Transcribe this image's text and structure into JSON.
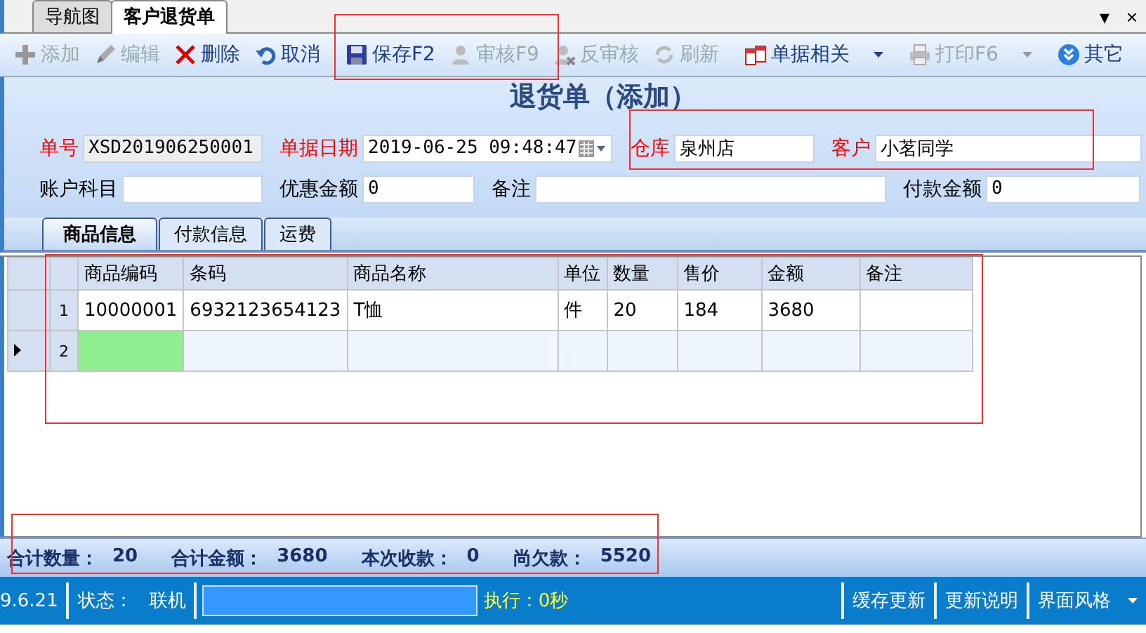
{
  "doc_tabs": [
    {
      "label": "导航图",
      "selected": false
    },
    {
      "label": "客户退货单",
      "selected": true
    }
  ],
  "window_controls": {
    "menu": "▾",
    "close": "×"
  },
  "toolbar": [
    {
      "label": "添加",
      "kind": "button",
      "disabled": true
    },
    {
      "label": "编辑",
      "kind": "button",
      "disabled": true
    },
    {
      "label": "删除",
      "kind": "button",
      "disabled": false
    },
    {
      "label": "取消",
      "kind": "button",
      "disabled": false
    },
    {
      "label": "保存F2",
      "kind": "button",
      "disabled": false
    },
    {
      "label": "审核F9",
      "kind": "button",
      "disabled": true
    },
    {
      "label": "反审核",
      "kind": "button",
      "disabled": true
    },
    {
      "label": "刷新",
      "kind": "button",
      "disabled": true
    },
    {
      "label": "单据相关",
      "kind": "dropdown",
      "disabled": false
    },
    {
      "label": "打印F6",
      "kind": "dropdown",
      "disabled": true
    },
    {
      "label": "其它",
      "kind": "dropdown",
      "disabled": false
    }
  ],
  "form": {
    "title": "退货单（添加）",
    "fields": [
      {
        "label": "单号",
        "required": true,
        "value": "XSD201906250001",
        "kind": "readonly"
      },
      {
        "label": "单据日期",
        "required": true,
        "value": "2019-06-25 09:48:47",
        "kind": "date"
      },
      {
        "label": "仓库",
        "required": true,
        "value": "泉州店",
        "kind": "text"
      },
      {
        "label": "客户",
        "required": true,
        "value": "小茗同学",
        "kind": "text"
      },
      {
        "label": "账户科目",
        "required": false,
        "kind": "text"
      },
      {
        "label": "优惠金额",
        "required": false,
        "value": "0",
        "kind": "text"
      },
      {
        "label": "备注",
        "required": false,
        "kind": "text"
      },
      {
        "label": "付款金额",
        "required": false,
        "value": "0",
        "kind": "text"
      }
    ]
  },
  "detail_tabs": [
    {
      "label": "商品信息",
      "selected": true
    },
    {
      "label": "付款信息",
      "selected": false
    },
    {
      "label": "运费",
      "selected": false
    }
  ],
  "table": {
    "columns": [
      "商品编码",
      "条码",
      "商品名称",
      "单位",
      "数量",
      "售价",
      "金额",
      "备注"
    ],
    "rows": [
      {
        "number": "1",
        "current": false,
        "cells": [
          "10000001",
          "6932123654123",
          "T恤",
          "件",
          "20",
          "184",
          "3680",
          ""
        ]
      },
      {
        "number": "2",
        "current": true,
        "cells": [
          "",
          "",
          "",
          "",
          "",
          "",
          "",
          ""
        ]
      }
    ]
  },
  "totals": [
    {
      "label": "合计数量：",
      "value": "20"
    },
    {
      "label": "合计金额：",
      "value": "3680"
    },
    {
      "label": "本次收款：",
      "value": "0"
    },
    {
      "label": "尚欠款：",
      "value": "5520"
    }
  ],
  "status_bar": {
    "version": "9.6.21",
    "state_label": "状态：",
    "state_value": "联机",
    "execution": "执行：0秒",
    "buttons": [
      {
        "label": "缓存更新",
        "kind": "button"
      },
      {
        "label": "更新说明",
        "kind": "button"
      },
      {
        "label": "界面风格",
        "kind": "dropdown"
      }
    ]
  },
  "annotation_frames": [
    {
      "kind": "rectangle"
    },
    {
      "kind": "rectangle"
    },
    {
      "kind": "rectangle"
    },
    {
      "kind": "rectangle"
    }
  ]
}
